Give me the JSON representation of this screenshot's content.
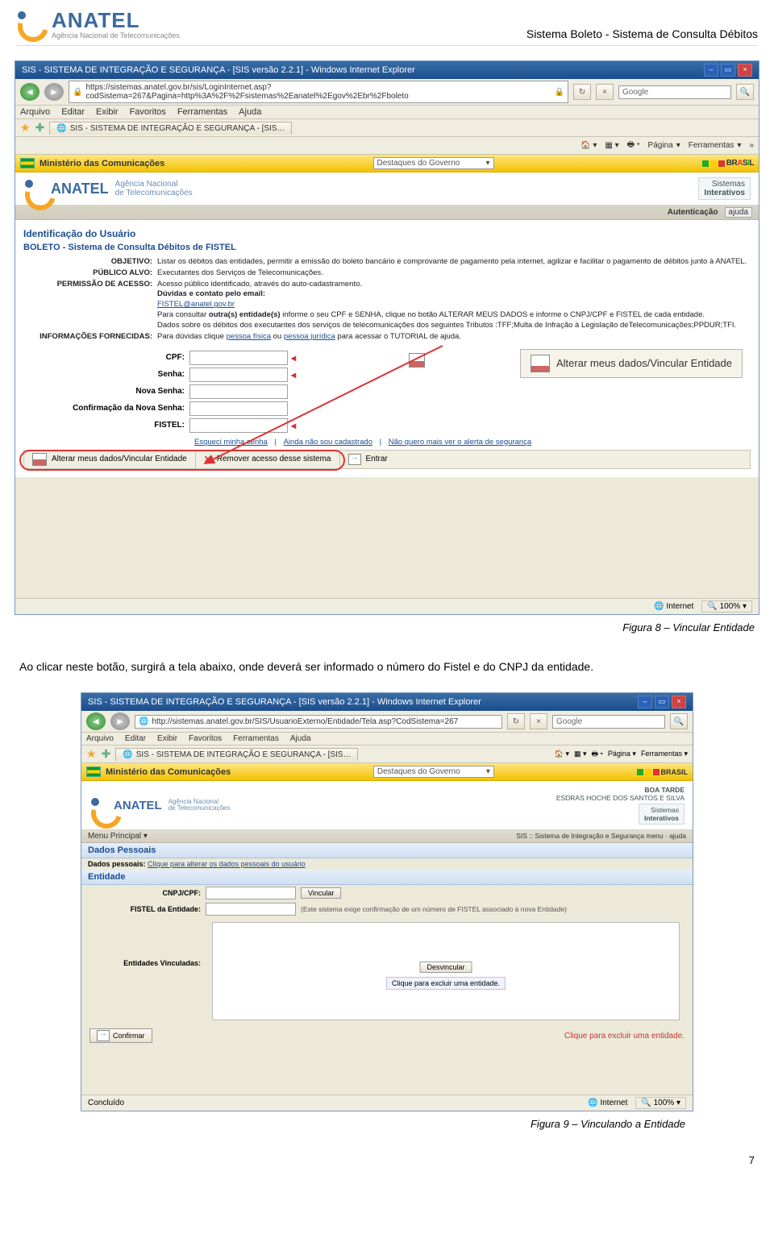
{
  "doc": {
    "brand": "ANATEL",
    "brand_sub": "Agência Nacional de Telecomunicações",
    "header_right": "Sistema Boleto - Sistema de Consulta Débitos",
    "caption1": "Figura 8 – Vincular Entidade",
    "body_text": "Ao clicar neste botão, surgirá a tela abaixo, onde deverá ser informado o número do Fistel e do CNPJ da entidade.",
    "caption2": "Figura 9 – Vinculando a Entidade",
    "page_number": "7"
  },
  "shot1": {
    "title": "SIS - SISTEMA DE INTEGRAÇÃO E SEGURANÇA - [SIS versão 2.2.1] - Windows Internet Explorer",
    "url": "https://sistemas.anatel.gov.br/sis/LoginInternet.asp?codSistema=267&Pagina=http%3A%2F%2Fsistemas%2Eanatel%2Egov%2Ebr%2Fboleto",
    "search_placeholder": "Google",
    "menu": [
      "Arquivo",
      "Editar",
      "Exibir",
      "Favoritos",
      "Ferramentas",
      "Ajuda"
    ],
    "tab": "SIS - SISTEMA DE INTEGRAÇÃO E SEGURANÇA - [SIS…",
    "ie_tools": {
      "page": "Página",
      "tools": "Ferramentas"
    },
    "gov": {
      "ministry": "Ministério das Comunicações",
      "select": "Destaques do Governo",
      "brasil": "BRASIL"
    },
    "banner": {
      "name": "ANATEL",
      "sub1": "Agência Nacional",
      "sub2": "de Telecomunicações",
      "right1": "Sistemas",
      "right2": "Interativos"
    },
    "auth": "Autenticação",
    "ajuda": "ajuda",
    "section": "Identificação do Usuário",
    "boleto": "BOLETO - Sistema de Consulta Débitos de FISTEL",
    "rows": {
      "objetivo_lbl": "OBJETIVO:",
      "objetivo": "Listar os débitos das entidades, permitir a emissão do boleto bancário e comprovante de pagamento pela internet, agilizar e facilitar o pagamento de débitos junto à ANATEL.",
      "publico_lbl": "PÚBLICO ALVO:",
      "publico": "Executantes dos Serviços de Telecomunicações.",
      "perm_lbl": "PERMISSÃO DE ACESSO:",
      "perm_l1": "Acesso público identificado, através do auto-cadastramento.",
      "perm_l2": "Dúvidas e contato pelo email:",
      "perm_email": "FISTEL@anatel.gov.br",
      "perm_l3a": "Para consultar ",
      "perm_l3b": "outra(s) entidade(s)",
      "perm_l3c": " informe o seu CPF e SENHA, clique no botão ALTERAR MEUS DADOS e informe o CNPJ/CPF e FISTEL de cada entidade.",
      "perm_l4": "Dados sobre os débitos dos executantes dos serviços de telecomunicações dos seguintes Tributos :TFF;Multa de Infração à Legislação deTelecomunicações;PPDUR;TFI.",
      "info_lbl": "INFORMAÇÕES FORNECIDAS:",
      "info": "Para dúvidas clique pessoa física ou pessoa jurídica para acessar o TUTORIAL de ajuda.",
      "info_link1": "pessoa física",
      "info_link2": "pessoa jurídica"
    },
    "form": {
      "cpf": "CPF:",
      "senha": "Senha:",
      "nsenha": "Nova Senha:",
      "csenha": "Confirmação da Nova Senha:",
      "fistel": "FISTEL:"
    },
    "biglink": "Alterar meus dados/Vincular Entidade",
    "underlinks": {
      "a": "Esqueci minha senha",
      "b": "Ainda não sou cadastrado",
      "c": "Não quero mais ver o alerta de segurança"
    },
    "actions": {
      "a1": "Alterar meus dados/Vincular Entidade",
      "a2": "Remover acesso desse sistema",
      "a3": "Entrar"
    },
    "status": {
      "internet": "Internet",
      "zoom": "100%"
    }
  },
  "shot2": {
    "title": "SIS - SISTEMA DE INTEGRAÇÃO E SEGURANÇA - [SIS versão 2.2.1] - Windows Internet Explorer",
    "url": "http://sistemas.anatel.gov.br/SIS/UsuarioExterno/Entidade/Tela.asp?CodSistema=267",
    "search_placeholder": "Google",
    "menu": [
      "Arquivo",
      "Editar",
      "Exibir",
      "Favoritos",
      "Ferramentas",
      "Ajuda"
    ],
    "tab": "SIS - SISTEMA DE INTEGRAÇÃO E SEGURANÇA - [SIS…",
    "ie_tools": {
      "page": "Página",
      "tools": "Ferramentas"
    },
    "gov": {
      "ministry": "Ministério das Comunicações",
      "select": "Destaques do Governo"
    },
    "banner": {
      "name": "ANATEL",
      "sub1": "Agência Nacional",
      "sub2": "de Telecomunicações",
      "greet": "BOA TARDE",
      "user": "ESDRAS HOCHE DOS SANTOS E SILVA",
      "right1": "Sistemas",
      "right2": "Interativos"
    },
    "menubar": {
      "left": "Menu Principal ▾",
      "right": "SIS :: Sistema de Integração e Segurança    menu · ajuda"
    },
    "dados_head": "Dados Pessoais",
    "dados_sub_lbl": "Dados pessoais:",
    "dados_sub_link": "Clique para alterar os dados pessoais do usuário",
    "ent_head": "Entidade",
    "cnpj_lbl": "CNPJ/CPF:",
    "vincular": "Vincular",
    "fistel_lbl": "FISTEL da Entidade:",
    "fistel_note": "(Este sistema exige confirmação de um número de FISTEL associado à nova Entidade)",
    "entvin_lbl": "Entidades Vinculadas:",
    "desvincular": "Desvincular",
    "hint": "Clique para excluir uma entidade.",
    "confirm": "Confirmar",
    "warn": "Clique para excluir uma entidade.",
    "status": {
      "done": "Concluído",
      "internet": "Internet",
      "zoom": "100%"
    }
  }
}
